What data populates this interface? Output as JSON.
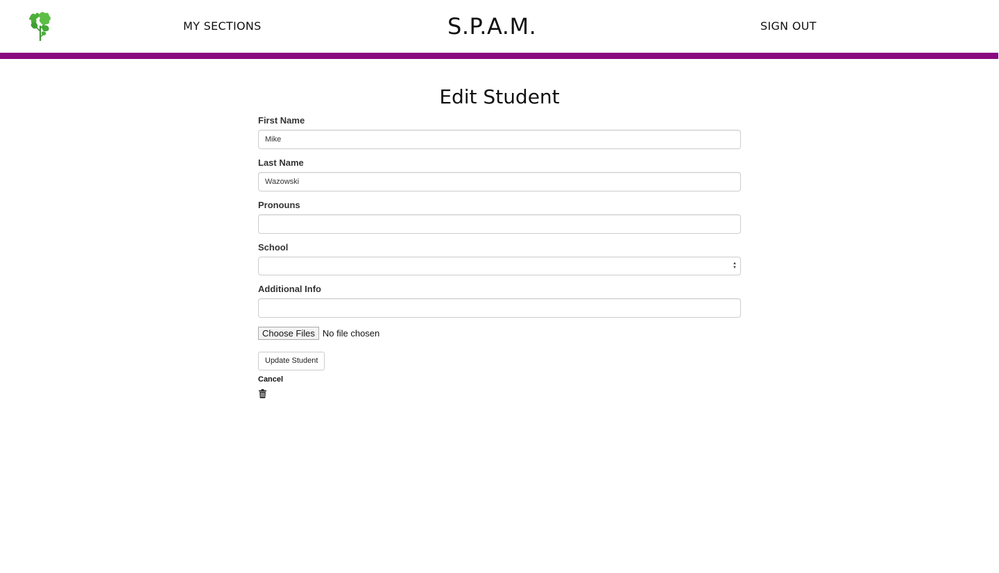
{
  "navbar": {
    "logo_icon": "parsley-icon",
    "sections_link": "MY SECTIONS",
    "brand": "S.P.A.M.",
    "signout_link": "SIGN OUT",
    "accent_color": "#8a0a7f"
  },
  "form": {
    "title": "Edit Student",
    "first_name": {
      "label": "First Name",
      "value": "Mike"
    },
    "last_name": {
      "label": "Last Name",
      "value": "Wazowski"
    },
    "pronouns": {
      "label": "Pronouns",
      "value": ""
    },
    "school": {
      "label": "School",
      "selected": ""
    },
    "additional_info": {
      "label": "Additional Info",
      "value": ""
    },
    "file_upload": {
      "button_label": "Choose Files",
      "status": "No file chosen"
    },
    "submit_label": "Update Student",
    "cancel_label": "Cancel",
    "delete_icon": "trash-icon"
  }
}
